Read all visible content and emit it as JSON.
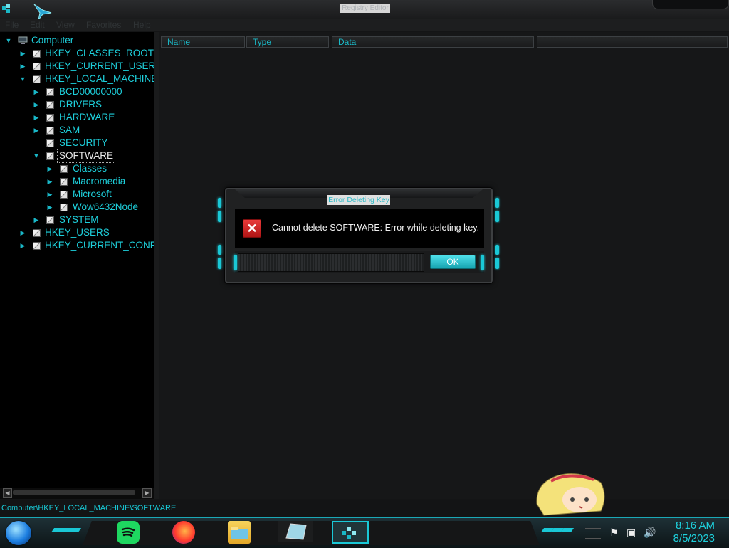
{
  "window": {
    "title": "Registry Editor"
  },
  "menu": [
    {
      "label": "File"
    },
    {
      "label": "Edit"
    },
    {
      "label": "View"
    },
    {
      "label": "Favorites"
    },
    {
      "label": "Help"
    }
  ],
  "tree": {
    "items": [
      {
        "label": "Computer",
        "expanded": true
      },
      {
        "label": "HKEY_CLASSES_ROOT",
        "expanded": false
      },
      {
        "label": "HKEY_CURRENT_USER",
        "expanded": false
      },
      {
        "label": "HKEY_LOCAL_MACHINE",
        "expanded": true
      },
      {
        "label": "BCD00000000",
        "expanded": false
      },
      {
        "label": "DRIVERS",
        "expanded": false
      },
      {
        "label": "HARDWARE",
        "expanded": false
      },
      {
        "label": "SAM",
        "expanded": false
      },
      {
        "label": "SECURITY",
        "expanded": false
      },
      {
        "label": "SOFTWARE",
        "expanded": true,
        "selected": true
      },
      {
        "label": "Classes",
        "expanded": false
      },
      {
        "label": "Macromedia",
        "expanded": false
      },
      {
        "label": "Microsoft",
        "expanded": false
      },
      {
        "label": "Wow6432Node",
        "expanded": false
      },
      {
        "label": "SYSTEM",
        "expanded": false
      },
      {
        "label": "HKEY_USERS",
        "expanded": false
      },
      {
        "label": "HKEY_CURRENT_CONFI",
        "expanded": false
      }
    ]
  },
  "list": {
    "columns": [
      {
        "label": "Name"
      },
      {
        "label": "Type"
      },
      {
        "label": "Data"
      }
    ]
  },
  "status": {
    "path": "Computer\\HKEY_LOCAL_MACHINE\\SOFTWARE"
  },
  "dialog": {
    "title": "Error Deleting Key",
    "message": "Cannot delete SOFTWARE:  Error while deleting key.",
    "ok_label": "OK"
  },
  "taskbar": {
    "apps": [
      "spotify-icon",
      "firefox-icon",
      "file-explorer-icon",
      "slate-icon",
      "registry-editor-icon"
    ],
    "clock_time": "8:16 AM",
    "clock_date": "8/5/2023"
  },
  "colors": {
    "accent": "#1ed0dc",
    "error": "#d42a2a"
  }
}
